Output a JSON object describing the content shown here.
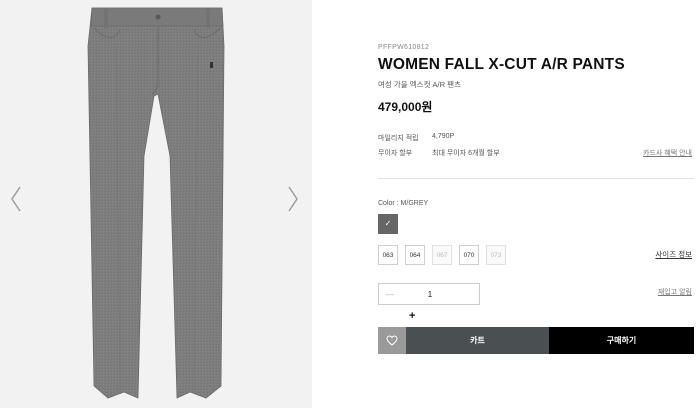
{
  "gallery": {
    "prev_icon": "chevron-left-icon",
    "next_icon": "chevron-right-icon",
    "product_color": "#7b7b7b"
  },
  "product": {
    "sku": "PFFPW610812",
    "title": "WOMEN FALL X-CUT A/R PANTS",
    "subtitle": "여성 가을 엑스컷 A/R 팬츠",
    "price": "479,000원"
  },
  "details": {
    "mileage_label": "마일리지 적립",
    "mileage_value": "4,790P",
    "installment_label": "무이자 할부",
    "installment_value": "최대 무이자 6개월 할부",
    "card_benefit_link": "카드사 혜택 안내"
  },
  "options": {
    "color_label": "Color : M/GREY",
    "swatch_color": "#666666",
    "swatch_check": "✓",
    "sizes": [
      {
        "label": "063",
        "available": true
      },
      {
        "label": "064",
        "available": true
      },
      {
        "label": "067",
        "available": false
      },
      {
        "label": "070",
        "available": true
      },
      {
        "label": "073",
        "available": false
      }
    ],
    "size_guide": "사이즈 정보"
  },
  "quantity": {
    "minus": "—",
    "value": "1",
    "plus": "+",
    "restock_link": "재입고 알림"
  },
  "actions": {
    "wish_icon": "heart-icon",
    "cart_label": "카트",
    "buy_label": "구매하기"
  }
}
